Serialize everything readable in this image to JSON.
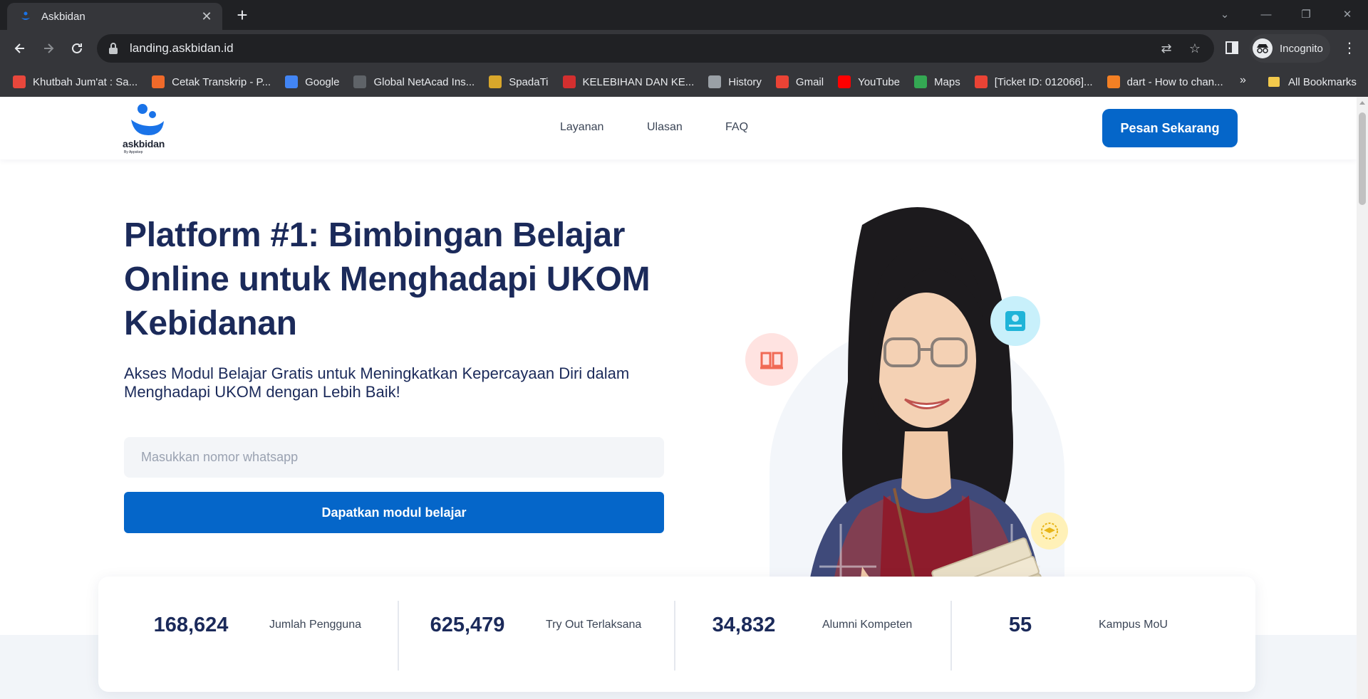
{
  "browser": {
    "tab_title": "Askbidan",
    "url": "landing.askbidan.id",
    "profile_label": "Incognito",
    "bookmarks": [
      {
        "label": "Khutbah Jum'at : Sa...",
        "icon": "plane-icon",
        "color": "#e8473c"
      },
      {
        "label": "Cetak Transkrip - P...",
        "icon": "school-icon",
        "color": "#f06a2a"
      },
      {
        "label": "Google",
        "icon": "google-icon",
        "color": "#4285f4"
      },
      {
        "label": "Global NetAcad Ins...",
        "icon": "cisco-icon",
        "color": "#5f6368"
      },
      {
        "label": "SpadaTi",
        "icon": "emblem-icon",
        "color": "#d9a72b"
      },
      {
        "label": "KELEBIHAN DAN KE...",
        "icon": "s-logo-icon",
        "color": "#d32f2f"
      },
      {
        "label": "History",
        "icon": "history-icon",
        "color": "#9aa0a6"
      },
      {
        "label": "Gmail",
        "icon": "gmail-icon",
        "color": "#ea4335"
      },
      {
        "label": "YouTube",
        "icon": "youtube-icon",
        "color": "#ff0000"
      },
      {
        "label": "Maps",
        "icon": "maps-icon",
        "color": "#34a853"
      },
      {
        "label": "[Ticket ID: 012066]...",
        "icon": "gmail-icon",
        "color": "#ea4335"
      },
      {
        "label": "dart - How to chan...",
        "icon": "stackoverflow-icon",
        "color": "#f48024"
      }
    ],
    "more_bookmarks": "»",
    "all_bookmarks_label": "All Bookmarks"
  },
  "header": {
    "logo_word": "askbidan",
    "logo_sub": "By Appskep",
    "nav": [
      "Layanan",
      "Ulasan",
      "FAQ"
    ],
    "cta_label": "Pesan Sekarang"
  },
  "hero": {
    "title": "Platform #1: Bimbingan Belajar Online untuk Menghadapi UKOM Kebidanan",
    "subtitle": "Akses Modul Belajar Gratis untuk Meningkatkan Kepercayaan Diri dalam Menghadapi UKOM dengan Lebih Baik!",
    "input_placeholder": "Masukkan nomor whatsapp",
    "button_label": "Dapatkan modul belajar"
  },
  "stats": [
    {
      "value": "168,624",
      "label": "Jumlah Pengguna"
    },
    {
      "value": "625,479",
      "label": "Try Out Terlaksana"
    },
    {
      "value": "34,832",
      "label": "Alumni Kompeten"
    },
    {
      "value": "55",
      "label": "Kampus MoU"
    }
  ],
  "colors": {
    "primary": "#0566c9",
    "heading": "#1b2a5a",
    "chrome_bg": "#35363a",
    "tabstrip_bg": "#202124"
  }
}
